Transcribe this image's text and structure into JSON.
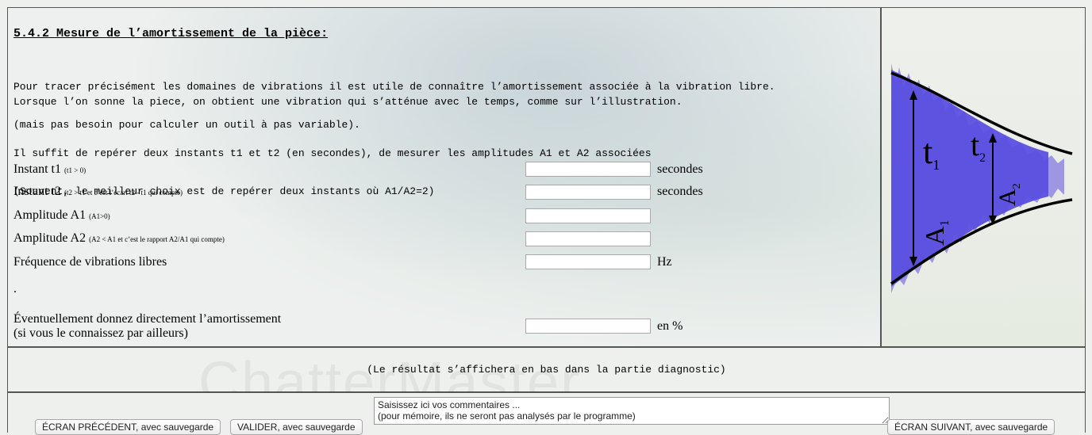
{
  "section": {
    "title": "5.4.2 Mesure de l’amortissement de la pièce:",
    "para1_line1": "Pour tracer précisément les domaines de vibrations il est utile de connaître l’amortissement associée à la vibration libre.",
    "para1_line2": "(mais pas besoin pour calculer un outil à pas variable).",
    "para2": "Lorsque l’on sonne la piece, on obtient une vibration qui s’atténue avec le temps, comme sur l’illustration.",
    "para3_line1": "Il suffit de repérer deux instants t1 et t2 (en secondes), de mesurer les amplitudes A1 et A2 associées",
    "para3_line2": "(Souvent, le meilleur choix est de repérer deux instants où A1/A2=2)"
  },
  "fields": {
    "t1": {
      "label": "Instant t1",
      "hint": "(t1 > 0)",
      "value": "",
      "unit": "secondes"
    },
    "t2": {
      "label": "Instant t2",
      "hint": "(t2 > t1 et c’est l’écart t2 - t1 qui compte)",
      "value": "",
      "unit": "secondes"
    },
    "a1": {
      "label": "Amplitude A1",
      "hint": "(A1>0)",
      "value": ""
    },
    "a2": {
      "label": "Amplitude A2",
      "hint": "(A2 < A1 et c’est le rapport A2/A1 qui compte)",
      "value": ""
    },
    "freq": {
      "label": "Fréquence de vibrations libres",
      "value": "",
      "unit": "Hz"
    },
    "dot": ".",
    "damping": {
      "label_line1": "Éventuellement donnez directement l’amortissement",
      "label_line2": "(si vous le connaissez par ailleurs)",
      "value": "",
      "unit": "en %"
    }
  },
  "illustration": {
    "t1": "t",
    "t1_sub": "1",
    "t2": "t",
    "t2_sub": "2",
    "a1": "A",
    "a1_sub": "1",
    "a2": "A",
    "a2_sub": "2",
    "fill_color": "#5b4fe0"
  },
  "result_note": "(Le résultat s’affichera en bas dans la partie diagnostic)",
  "watermark": "ChatterMaster",
  "buttons": {
    "prev": "ÉCRAN PRÉCÉDENT, avec sauvegarde",
    "validate": "VALIDER, avec sauvegarde",
    "next": "ÉCRAN SUIVANT, avec sauvegarde"
  },
  "comments": {
    "line1": "Saisissez ici vos commentaires ...",
    "line2": "(pour mémoire, ils ne seront pas analysés par le programme)"
  }
}
